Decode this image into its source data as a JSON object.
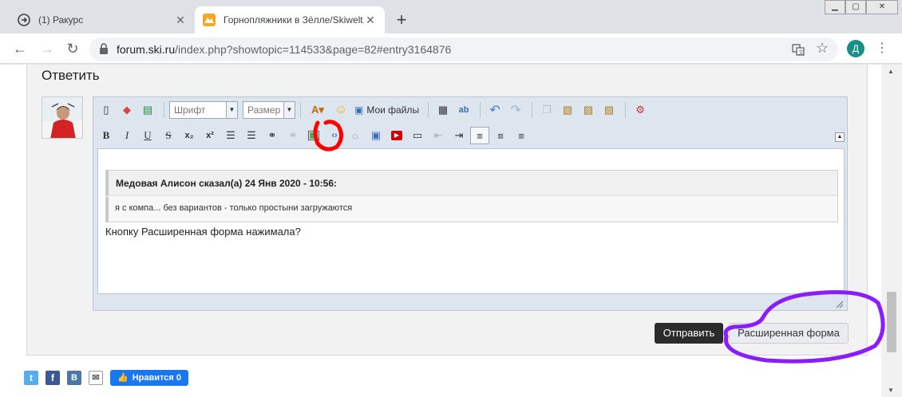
{
  "browser": {
    "tabs": [
      {
        "title": "(1) Ракурс",
        "active": false
      },
      {
        "title": "Горнопляжники в Зёлле/Skiwelt,",
        "active": true
      }
    ],
    "url_host": "forum.ski.ru",
    "url_path": "/index.php?showtopic=114533&page=82#entry3164876",
    "profile_initial": "Д",
    "colors": {
      "profile": "#1a8f8a",
      "tab_favicon": "#f5a623"
    }
  },
  "reply": {
    "title": "Ответить",
    "toolbar": {
      "font_label": "Шрифт",
      "size_label": "Размер",
      "my_files_label": "Мои файлы"
    },
    "quote": {
      "header": "Медовая Алисон сказал(а) 24 Янв 2020 - 10:56:",
      "body": "я с компа... без вариантов - только простыни загружаются"
    },
    "text": "Кнопку Расширенная форма нажимала?",
    "send_label": "Отправить",
    "advanced_label": "Расширенная форма"
  },
  "share": {
    "like_label": "Нравится 0",
    "colors": {
      "twitter": "#55acee",
      "facebook": "#3b5998",
      "vk": "#4a76a8",
      "mail": "#8a8a8a",
      "like": "#1877f2"
    }
  },
  "annotations": {
    "colors": {
      "red_circle": "#ff0000",
      "purple_circle": "#8b1cff"
    }
  }
}
